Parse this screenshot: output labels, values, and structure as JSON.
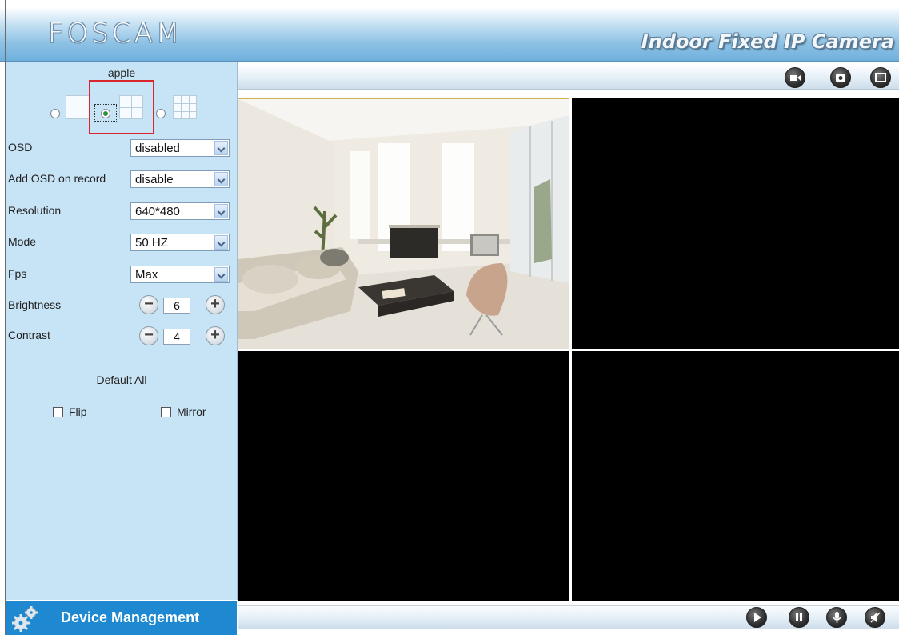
{
  "header": {
    "logo": "FOSCAM",
    "product_title": "Indoor Fixed IP Camera"
  },
  "left_panel": {
    "device_name": "apple",
    "layout_options": [
      "single",
      "quad",
      "nine"
    ],
    "selected_layout": "quad",
    "controls": [
      {
        "label": "OSD",
        "value": "disabled"
      },
      {
        "label": "Add OSD on record",
        "value": "disable"
      },
      {
        "label": "Resolution",
        "value": "640*480"
      },
      {
        "label": "Mode",
        "value": "50 HZ"
      },
      {
        "label": "Fps",
        "value": "Max"
      }
    ],
    "brightness": {
      "label": "Brightness",
      "value": "6"
    },
    "contrast": {
      "label": "Contrast",
      "value": "4"
    },
    "stepper": {
      "minus": "−",
      "plus": "+"
    },
    "default_all": "Default All",
    "flip_label": "Flip",
    "mirror_label": "Mirror",
    "flip_checked": false,
    "mirror_checked": false
  },
  "footer": {
    "device_management": "Device Management"
  },
  "toolbar_top": {
    "icons": [
      "record-icon",
      "snapshot-icon",
      "fullscreen-icon"
    ]
  },
  "toolbar_bottom": {
    "icons": [
      "play-icon",
      "pause-icon",
      "talk-icon",
      "audio-icon"
    ]
  },
  "colors": {
    "panel_bg": "#c7e3f6",
    "accent": "#1e89d1",
    "highlight": "#d9252b"
  }
}
